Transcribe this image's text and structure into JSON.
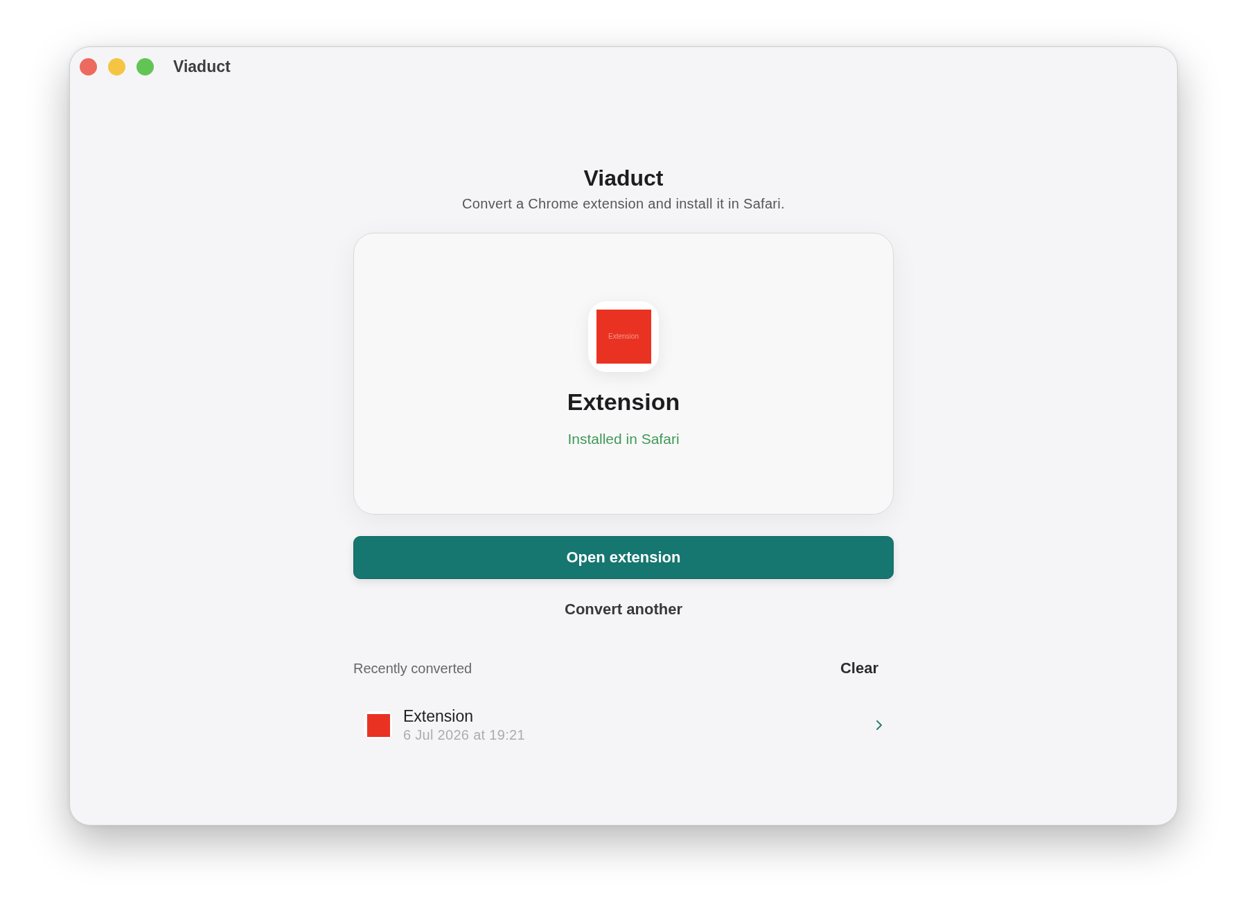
{
  "window": {
    "title": "Viaduct"
  },
  "header": {
    "title": "Viaduct",
    "subtitle": "Convert a Chrome extension and install it in Safari."
  },
  "result_card": {
    "icon_label": "Extension",
    "name": "Extension",
    "status": "Installed in Safari"
  },
  "primary_button": {
    "label": "Open extension"
  },
  "secondary_button": {
    "label": "Convert another"
  },
  "recent": {
    "title": "Recently converted",
    "clear_button": "Clear",
    "items": [
      {
        "name": "Extension",
        "date": "6 Jul 2026 at 19:21"
      }
    ]
  }
}
